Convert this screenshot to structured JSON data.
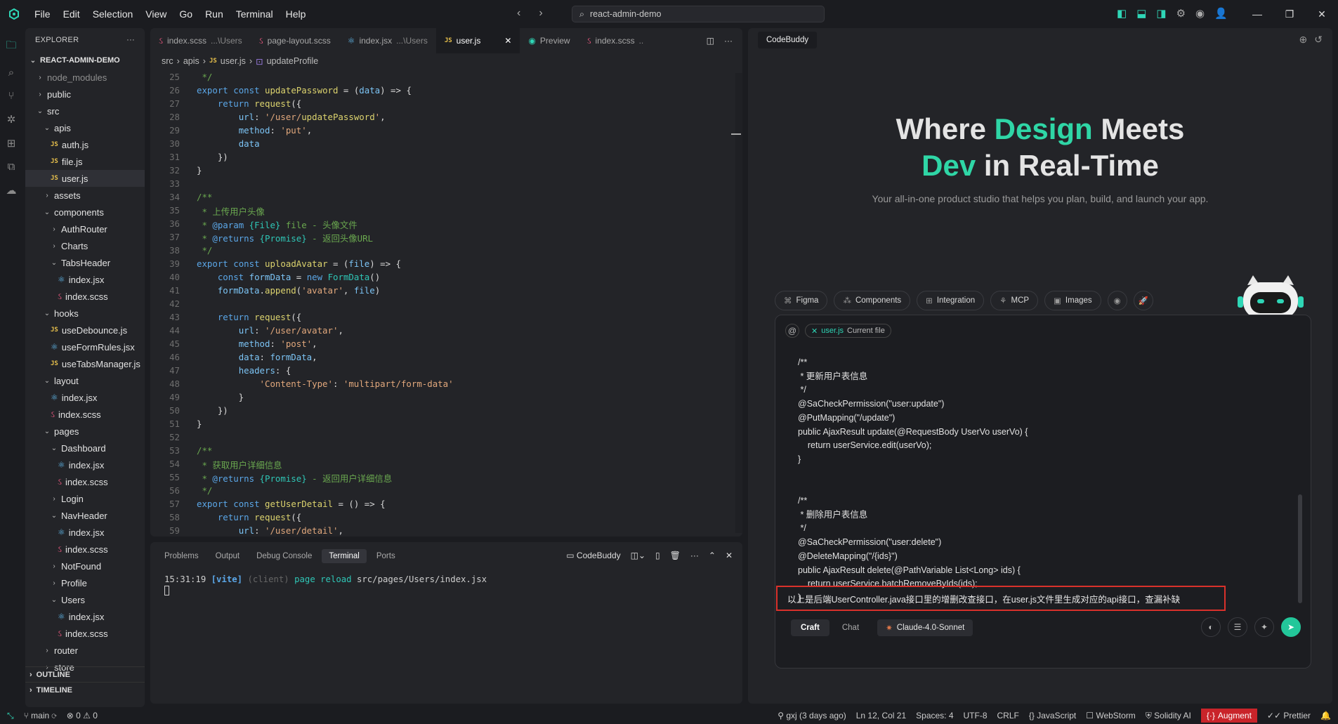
{
  "titlebar": {
    "menu": [
      "File",
      "Edit",
      "Selection",
      "View",
      "Go",
      "Run",
      "Terminal",
      "Help"
    ],
    "search_text": "react-admin-demo",
    "icons": [
      "layout-sidebar-icon",
      "layout-panel-icon",
      "layout-secondary-icon",
      "gear-icon",
      "copilot-icon",
      "account-icon"
    ]
  },
  "explorer": {
    "title": "EXPLORER",
    "root": "REACT-ADMIN-DEMO",
    "items": [
      {
        "label": "node_modules",
        "depth": 1,
        "kind": "folder",
        "open": false,
        "dim": true
      },
      {
        "label": "public",
        "depth": 1,
        "kind": "folder",
        "open": false
      },
      {
        "label": "src",
        "depth": 1,
        "kind": "folder",
        "open": true
      },
      {
        "label": "apis",
        "depth": 2,
        "kind": "folder",
        "open": true
      },
      {
        "label": "auth.js",
        "depth": 3,
        "kind": "js"
      },
      {
        "label": "file.js",
        "depth": 3,
        "kind": "js"
      },
      {
        "label": "user.js",
        "depth": 3,
        "kind": "js",
        "selected": true
      },
      {
        "label": "assets",
        "depth": 2,
        "kind": "folder",
        "open": false
      },
      {
        "label": "components",
        "depth": 2,
        "kind": "folder",
        "open": true
      },
      {
        "label": "AuthRouter",
        "depth": 3,
        "kind": "folder",
        "open": false
      },
      {
        "label": "Charts",
        "depth": 3,
        "kind": "folder",
        "open": false
      },
      {
        "label": "TabsHeader",
        "depth": 3,
        "kind": "folder",
        "open": true
      },
      {
        "label": "index.jsx",
        "depth": 4,
        "kind": "react"
      },
      {
        "label": "index.scss",
        "depth": 4,
        "kind": "sass"
      },
      {
        "label": "hooks",
        "depth": 2,
        "kind": "folder",
        "open": true
      },
      {
        "label": "useDebounce.js",
        "depth": 3,
        "kind": "js"
      },
      {
        "label": "useFormRules.jsx",
        "depth": 3,
        "kind": "react"
      },
      {
        "label": "useTabsManager.js",
        "depth": 3,
        "kind": "js"
      },
      {
        "label": "layout",
        "depth": 2,
        "kind": "folder",
        "open": true
      },
      {
        "label": "index.jsx",
        "depth": 3,
        "kind": "react"
      },
      {
        "label": "index.scss",
        "depth": 3,
        "kind": "sass"
      },
      {
        "label": "pages",
        "depth": 2,
        "kind": "folder",
        "open": true
      },
      {
        "label": "Dashboard",
        "depth": 3,
        "kind": "folder",
        "open": true
      },
      {
        "label": "index.jsx",
        "depth": 4,
        "kind": "react"
      },
      {
        "label": "index.scss",
        "depth": 4,
        "kind": "sass"
      },
      {
        "label": "Login",
        "depth": 3,
        "kind": "folder",
        "open": false
      },
      {
        "label": "NavHeader",
        "depth": 3,
        "kind": "folder",
        "open": true
      },
      {
        "label": "index.jsx",
        "depth": 4,
        "kind": "react"
      },
      {
        "label": "index.scss",
        "depth": 4,
        "kind": "sass"
      },
      {
        "label": "NotFound",
        "depth": 3,
        "kind": "folder",
        "open": false
      },
      {
        "label": "Profile",
        "depth": 3,
        "kind": "folder",
        "open": false
      },
      {
        "label": "Users",
        "depth": 3,
        "kind": "folder",
        "open": true
      },
      {
        "label": "index.jsx",
        "depth": 4,
        "kind": "react"
      },
      {
        "label": "index.scss",
        "depth": 4,
        "kind": "sass"
      },
      {
        "label": "router",
        "depth": 2,
        "kind": "folder",
        "open": false
      },
      {
        "label": "store",
        "depth": 2,
        "kind": "folder",
        "open": false
      }
    ],
    "outline": "OUTLINE",
    "timeline": "TIMELINE"
  },
  "editor": {
    "tabs": [
      {
        "name": "index.scss",
        "path": "...\\Users",
        "icon": "sass"
      },
      {
        "name": "page-layout.scss",
        "path": "",
        "icon": "sass"
      },
      {
        "name": "index.jsx",
        "path": "...\\Users",
        "icon": "react"
      },
      {
        "name": "user.js",
        "path": "",
        "icon": "js",
        "active": true
      },
      {
        "name": "Preview",
        "path": "",
        "icon": "preview"
      },
      {
        "name": "index.scss",
        "path": "..",
        "icon": "sass"
      }
    ],
    "breadcrumb": [
      "src",
      "apis",
      "user.js",
      "updateProfile"
    ],
    "lines": [
      {
        "n": "25",
        "html": " */",
        "cls": "c"
      },
      {
        "n": "26",
        "code": "export const updatePassword = (data) => {"
      },
      {
        "n": "27",
        "code": "    return request({"
      },
      {
        "n": "28",
        "code": "        url: '/user/updatePassword',"
      },
      {
        "n": "29",
        "code": "        method: 'put',"
      },
      {
        "n": "30",
        "code": "        data"
      },
      {
        "n": "31",
        "code": "    })"
      },
      {
        "n": "32",
        "code": "}"
      },
      {
        "n": "33",
        "code": ""
      },
      {
        "n": "34",
        "code": "/**"
      },
      {
        "n": "35",
        "code": " * 上传用户头像"
      },
      {
        "n": "36",
        "code": " * @param {File} file - 头像文件"
      },
      {
        "n": "37",
        "code": " * @returns {Promise} - 返回头像URL"
      },
      {
        "n": "38",
        "code": " */"
      },
      {
        "n": "39",
        "code": "export const uploadAvatar = (file) => {"
      },
      {
        "n": "40",
        "code": "    const formData = new FormData()"
      },
      {
        "n": "41",
        "code": "    formData.append('avatar', file)"
      },
      {
        "n": "42",
        "code": ""
      },
      {
        "n": "43",
        "code": "    return request({"
      },
      {
        "n": "44",
        "code": "        url: '/user/avatar',"
      },
      {
        "n": "45",
        "code": "        method: 'post',"
      },
      {
        "n": "46",
        "code": "        data: formData,"
      },
      {
        "n": "47",
        "code": "        headers: {"
      },
      {
        "n": "48",
        "code": "            'Content-Type': 'multipart/form-data'"
      },
      {
        "n": "49",
        "code": "        }"
      },
      {
        "n": "50",
        "code": "    })"
      },
      {
        "n": "51",
        "code": "}"
      },
      {
        "n": "52",
        "code": ""
      },
      {
        "n": "53",
        "code": "/**"
      },
      {
        "n": "54",
        "code": " * 获取用户详细信息"
      },
      {
        "n": "55",
        "code": " * @returns {Promise} - 返回用户详细信息"
      },
      {
        "n": "56",
        "code": " */"
      },
      {
        "n": "57",
        "code": "export const getUserDetail = () => {"
      },
      {
        "n": "58",
        "code": "    return request({"
      },
      {
        "n": "59",
        "code": "        url: '/user/detail',"
      }
    ]
  },
  "panel": {
    "tabs": [
      "Problems",
      "Output",
      "Debug Console",
      "Terminal",
      "Ports"
    ],
    "active_tab": "Terminal",
    "terminal_name": "CodeBuddy",
    "terminal_line": {
      "time": "15:31:19",
      "tag": "[vite]",
      "client": "(client)",
      "text": "page reload",
      "path": "src/pages/Users/index.jsx"
    }
  },
  "codebuddy": {
    "tab": "CodeBuddy",
    "hero_a": "Where ",
    "hero_b": "Design",
    "hero_c": " Meets",
    "hero_d": "Dev",
    "hero_e": " in Real-Time",
    "subtitle": "Your all-in-one product studio that helps you plan, build, and launch your app.",
    "chips": [
      "Figma",
      "Components",
      "Integration",
      "MCP",
      "Images"
    ],
    "context_at": "@",
    "context_file": "user.js",
    "context_label": "Current file",
    "message_code": "/**\n * 更新用户表信息\n */\n@SaCheckPermission(\"user:update\")\n@PutMapping(\"/update\")\npublic AjaxResult update(@RequestBody UserVo userVo) {\n    return userService.edit(userVo);\n}\n\n\n/**\n * 删除用户表信息\n */\n@SaCheckPermission(\"user:delete\")\n@DeleteMapping(\"/{ids}\")\npublic AjaxResult delete(@PathVariable List<Long> ids) {\n    return userService.batchRemoveByIds(ids);\n}",
    "prompt": "以上是后端UserController.java接口里的增删改查接口，在user.js文件里生成对应的api接口，查漏补缺",
    "modes": [
      "Craft",
      "Chat"
    ],
    "active_mode": "Craft",
    "model": "Claude-4.0-Sonnet"
  },
  "statusbar": {
    "branch": "main",
    "problems": "0",
    "warnings": "0",
    "blame": "gxj (3 days ago)",
    "position": "Ln 12, Col 21",
    "spaces": "Spaces: 4",
    "encoding": "UTF-8",
    "eol": "CRLF",
    "language": "JavaScript",
    "webstorm": "WebStorm",
    "solidity": "Solidity AI",
    "augment": "Augment",
    "prettier": "Prettier"
  },
  "colors": {
    "accent": "#2fd6b6",
    "highlight_border": "#d9312b",
    "augment_bg": "#c9242a"
  }
}
